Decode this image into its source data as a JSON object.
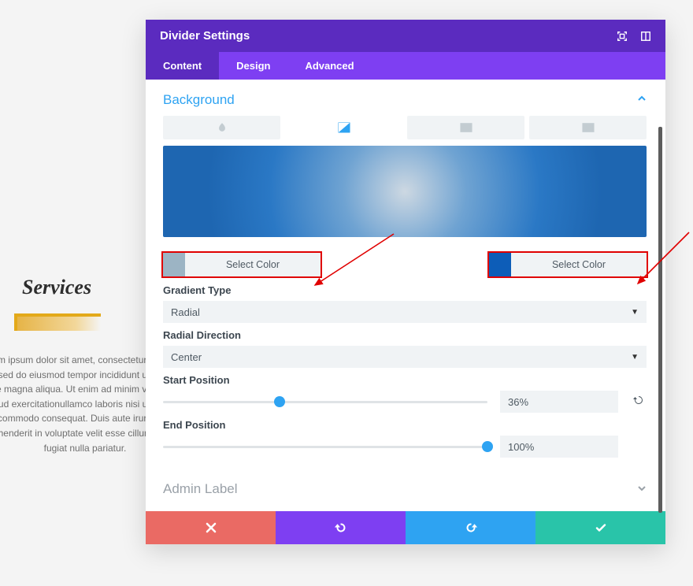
{
  "page": {
    "services_title": "Services",
    "lorem": "Lorem ipsum dolor sit amet, consectetur adipiscing elit, sed do eiusmod tempor incididunt ut labore et dolore magna aliqua. Ut enim ad minim veniam, quis nostrud exercitationullamco laboris nisi ut aliquip ex ea commodo consequat. Duis aute irure dolor in reprehenderit in voluptate velit esse cillum dolore eu fugiat nulla pariatur."
  },
  "modal": {
    "title": "Divider Settings",
    "tabs": {
      "content": "Content",
      "design": "Design",
      "advanced": "Advanced"
    },
    "section_background": "Background",
    "color_picker": {
      "left_label": "Select Color",
      "right_label": "Select Color",
      "left_color": "#9cb4c4",
      "right_color": "#0d5db8"
    },
    "gradient_type": {
      "label": "Gradient Type",
      "value": "Radial"
    },
    "radial_direction": {
      "label": "Radial Direction",
      "value": "Center"
    },
    "start_position": {
      "label": "Start Position",
      "value": "36%"
    },
    "end_position": {
      "label": "End Position",
      "value": "100%"
    },
    "admin_label": "Admin Label"
  }
}
